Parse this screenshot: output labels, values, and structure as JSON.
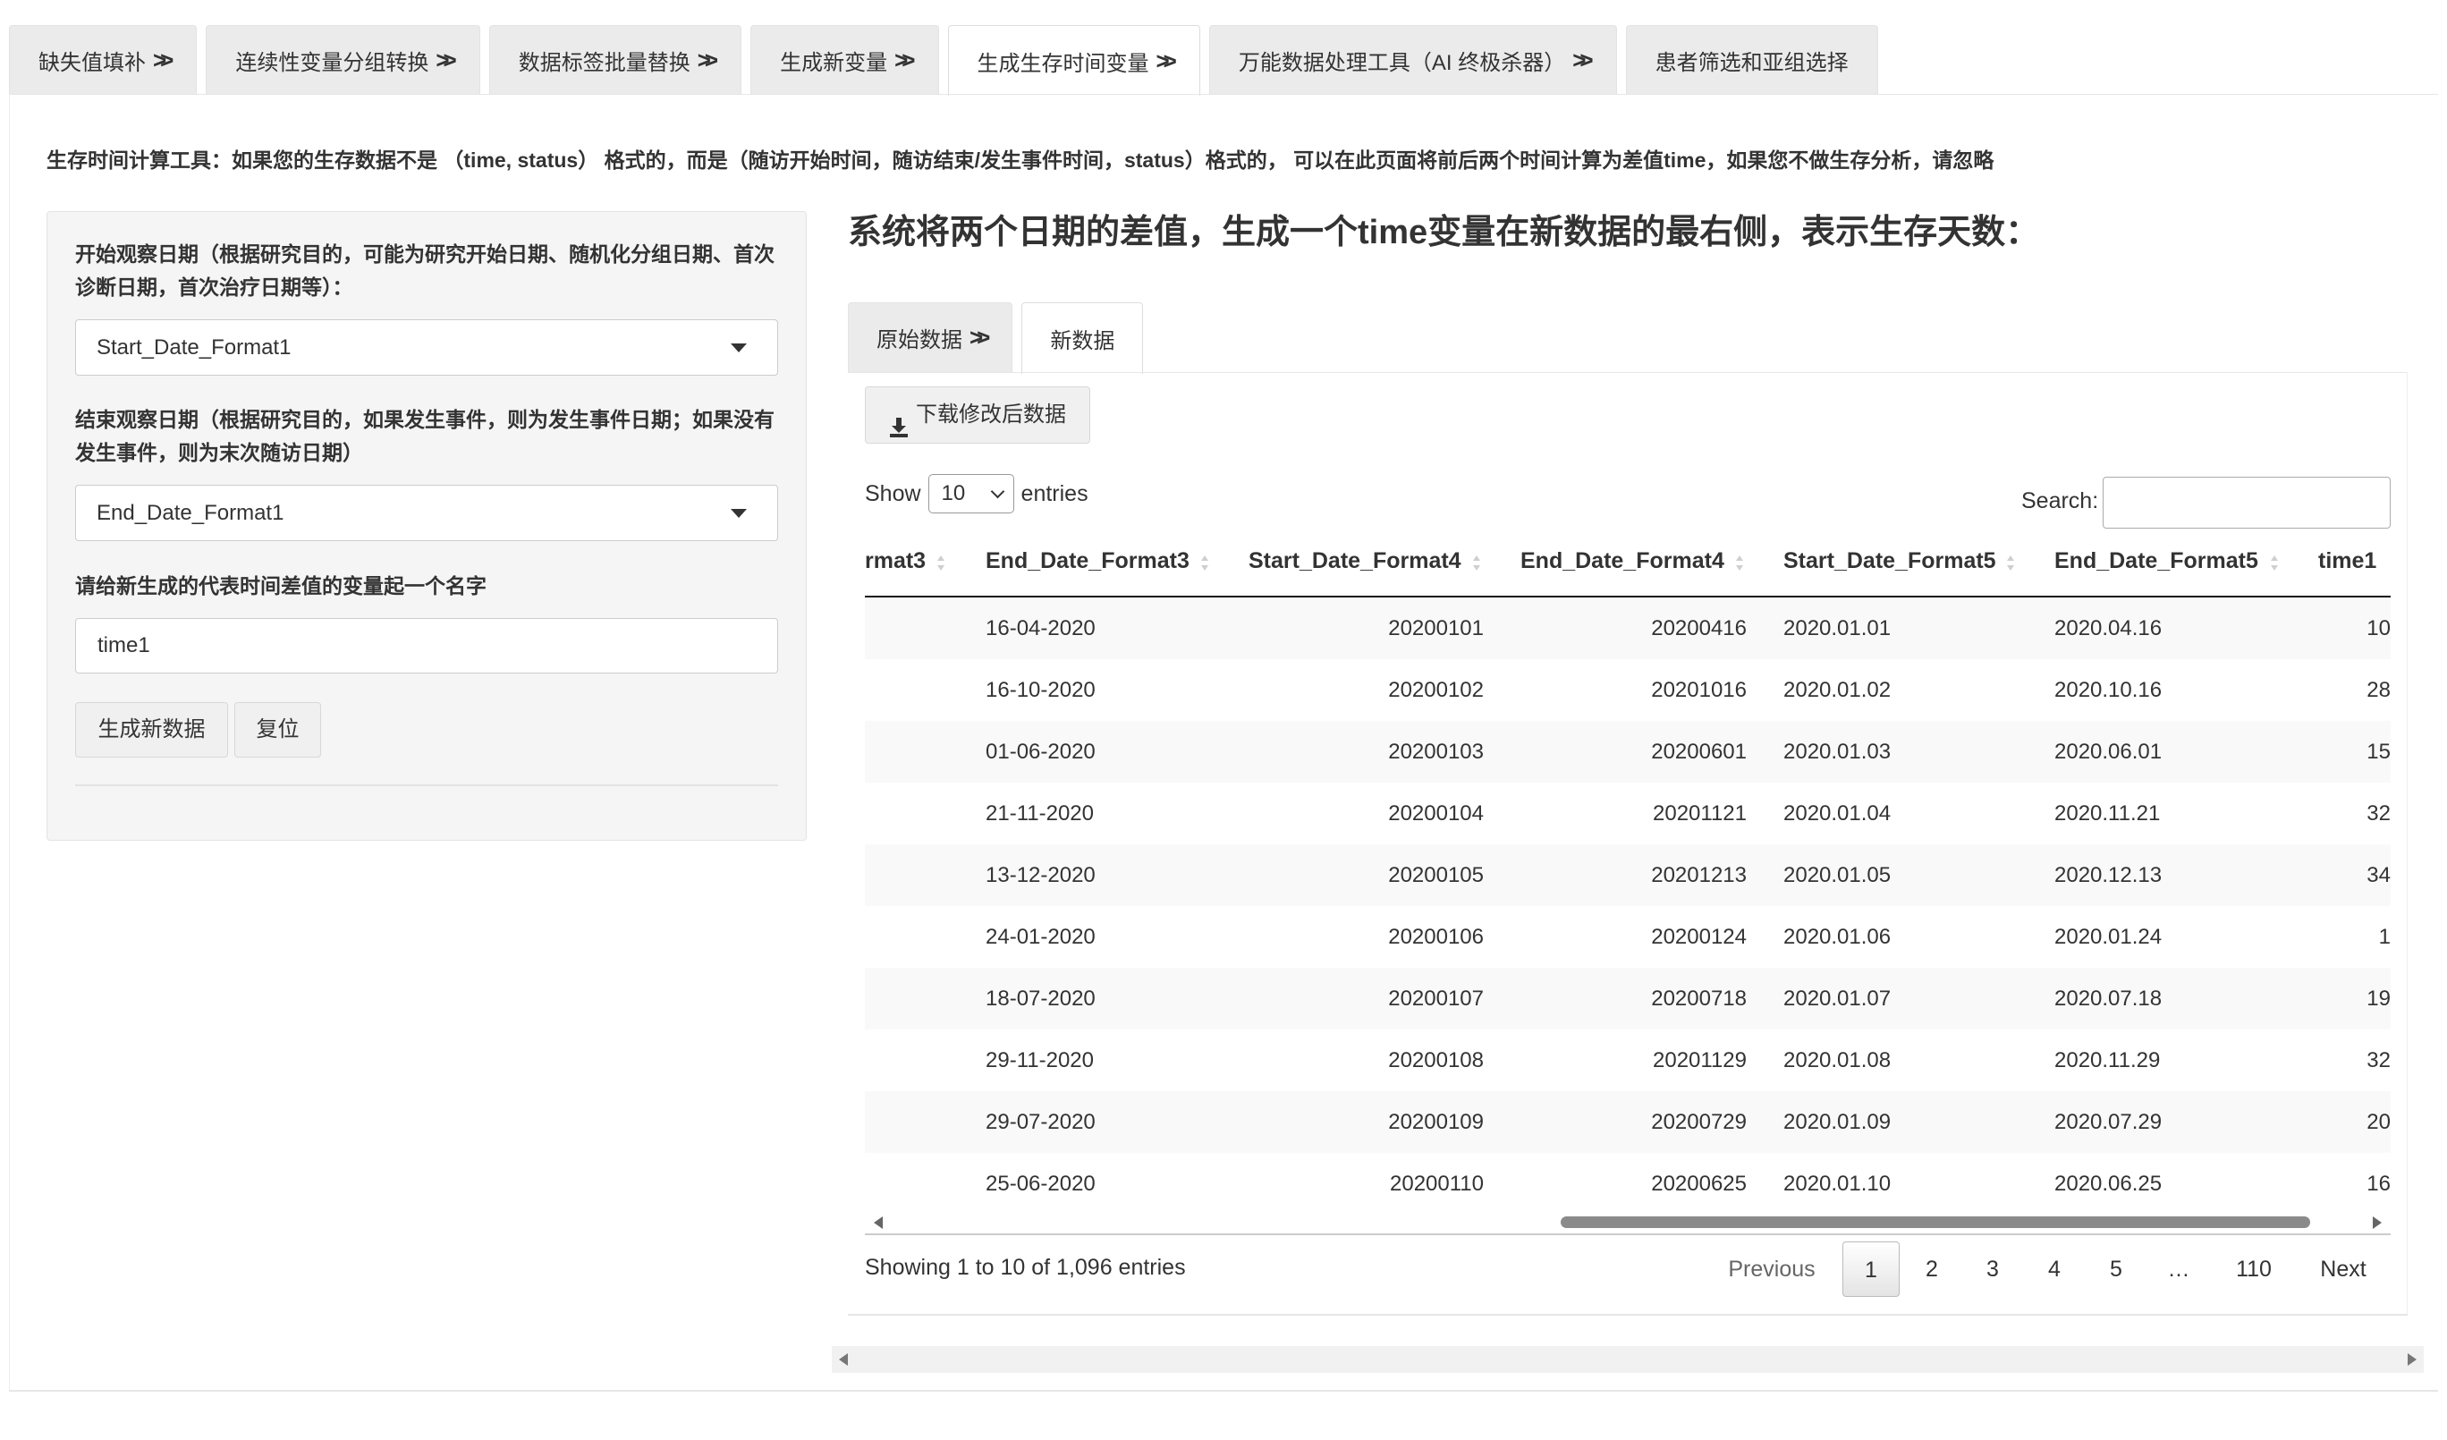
{
  "top_tabs": [
    {
      "label": "缺失值填补",
      "chevron": true
    },
    {
      "label": "连续性变量分组转换",
      "chevron": true
    },
    {
      "label": "数据标签批量替换",
      "chevron": true
    },
    {
      "label": "生成新变量",
      "chevron": true
    },
    {
      "label": "生成生存时间变量",
      "chevron": true,
      "active": true
    },
    {
      "label": "万能数据处理工具（AI 终极杀器）",
      "chevron": true
    },
    {
      "label": "患者筛选和亚组选择",
      "chevron": false
    }
  ],
  "intro_text": "生存时间计算工具：如果您的生存数据不是 （time, status） 格式的，而是（随访开始时间，随访结束/发生事件时间，status）格式的， 可以在此页面将前后两个时间计算为差值time，如果您不做生存分析，请忽略",
  "sidebar": {
    "start_label": "开始观察日期（根据研究目的，可能为研究开始日期、随机化分组日期、首次诊断日期，首次治疗日期等）：",
    "start_value": "Start_Date_Format1",
    "end_label": "结束观察日期（根据研究目的，如果发生事件，则为发生事件日期；如果没有发生事件，则为末次随访日期）",
    "end_value": "End_Date_Format1",
    "name_label": "请给新生成的代表时间差值的变量起一个名字",
    "name_value": "time1",
    "generate_button": "生成新数据",
    "reset_button": "复位"
  },
  "main": {
    "heading": "系统将两个日期的差值，生成一个time变量在新数据的最右侧，表示生存天数：",
    "tabs": [
      {
        "label": "原始数据",
        "chevron": true
      },
      {
        "label": "新数据",
        "chevron": false,
        "active": true
      }
    ],
    "download_button": "下载修改后数据",
    "show_label": "Show",
    "page_length": "10",
    "entries_label": "entries",
    "search_label": "Search:",
    "search_value": ""
  },
  "table": {
    "columns": [
      "rmat3",
      "End_Date_Format3",
      "Start_Date_Format4",
      "End_Date_Format4",
      "Start_Date_Format5",
      "End_Date_Format5",
      "time1"
    ],
    "rows": [
      [
        "",
        "16-04-2020",
        "20200101",
        "20200416",
        "2020.01.01",
        "2020.04.16",
        "10"
      ],
      [
        "",
        "16-10-2020",
        "20200102",
        "20201016",
        "2020.01.02",
        "2020.10.16",
        "28"
      ],
      [
        "",
        "01-06-2020",
        "20200103",
        "20200601",
        "2020.01.03",
        "2020.06.01",
        "15"
      ],
      [
        "",
        "21-11-2020",
        "20200104",
        "20201121",
        "2020.01.04",
        "2020.11.21",
        "32"
      ],
      [
        "",
        "13-12-2020",
        "20200105",
        "20201213",
        "2020.01.05",
        "2020.12.13",
        "34"
      ],
      [
        "",
        "24-01-2020",
        "20200106",
        "20200124",
        "2020.01.06",
        "2020.01.24",
        "1"
      ],
      [
        "",
        "18-07-2020",
        "20200107",
        "20200718",
        "2020.01.07",
        "2020.07.18",
        "19"
      ],
      [
        "",
        "29-11-2020",
        "20200108",
        "20201129",
        "2020.01.08",
        "2020.11.29",
        "32"
      ],
      [
        "",
        "29-07-2020",
        "20200109",
        "20200729",
        "2020.01.09",
        "2020.07.29",
        "20"
      ],
      [
        "",
        "25-06-2020",
        "20200110",
        "20200625",
        "2020.01.10",
        "2020.06.25",
        "16"
      ]
    ]
  },
  "footer": {
    "info": "Showing 1 to 10 of 1,096 entries",
    "prev_label": "Previous",
    "next_label": "Next",
    "pages": [
      "1",
      "2",
      "3",
      "4",
      "5",
      "…",
      "110"
    ],
    "current_page": "1"
  },
  "icons": {
    "tab_chevron": "double-chevron-right-icon",
    "select_caret": "caret-down-icon",
    "download": "download-icon"
  }
}
